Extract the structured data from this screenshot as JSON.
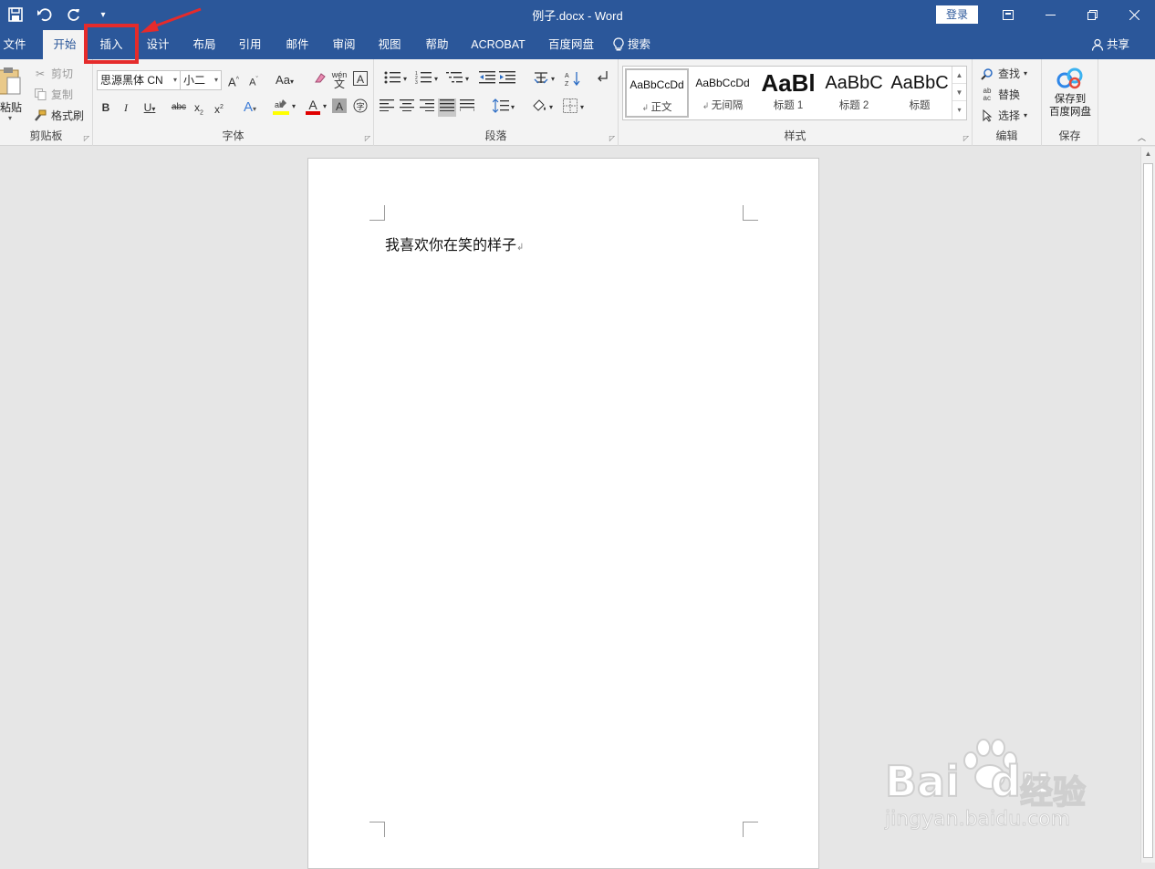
{
  "titlebar": {
    "doc_title": "例子.docx  -  Word",
    "login": "登录"
  },
  "qat": {
    "save_icon": "save-icon",
    "undo_icon": "undo-icon",
    "redo_icon": "redo-icon",
    "customize_icon": "customize-icon"
  },
  "tabs": [
    "文件",
    "开始",
    "插入",
    "设计",
    "布局",
    "引用",
    "邮件",
    "审阅",
    "视图",
    "帮助",
    "ACROBAT",
    "百度网盘"
  ],
  "tell_me": "搜索",
  "share": "共享",
  "clipboard": {
    "paste": "粘贴",
    "cut": "剪切",
    "copy": "复制",
    "format_painter": "格式刷",
    "label": "剪贴板"
  },
  "font": {
    "font_name": "思源黑体 CN",
    "font_size": "小二",
    "label": "字体"
  },
  "paragraph": {
    "label": "段落"
  },
  "styles": {
    "items": [
      {
        "sample": "AaBbCcDd",
        "name": "正文"
      },
      {
        "sample": "AaBbCcDd",
        "name": "无间隔"
      },
      {
        "sample": "AaBl",
        "name": "标题 1"
      },
      {
        "sample": "AaBbC",
        "name": "标题 2"
      },
      {
        "sample": "AaBbC",
        "name": "标题"
      }
    ],
    "label": "样式"
  },
  "editing": {
    "find": "查找",
    "replace": "替换",
    "select": "选择",
    "label": "编辑"
  },
  "save_group": {
    "save_to_line1": "保存到",
    "save_to_line2": "百度网盘",
    "label": "保存"
  },
  "document": {
    "text": "我喜欢你在笑的样子"
  },
  "watermark": {
    "brand": "Bai",
    "brand2": "du",
    "cn": "经验",
    "url": "jingyan.baidu.com"
  },
  "colors": {
    "accent": "#2b579a",
    "highlight_box": "#e52b2b",
    "ribbon_bg": "#f3f3f3"
  }
}
